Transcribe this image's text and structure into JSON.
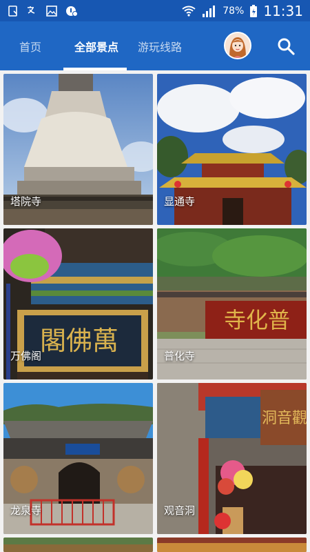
{
  "status_bar": {
    "battery": "78%",
    "time": "11:31"
  },
  "tabs": [
    {
      "label": "首页",
      "selected": false
    },
    {
      "label": "全部景点",
      "selected": true
    },
    {
      "label": "游玩线路",
      "selected": false
    }
  ],
  "icons": {
    "search": "search-icon",
    "avatar": "avatar"
  },
  "colors": {
    "status_bar": "#1757b2",
    "app_bar": "#1f67c4",
    "background": "#f2f2f2"
  },
  "cards": [
    {
      "label": "塔院寺"
    },
    {
      "label": "显通寺"
    },
    {
      "label": "万佛阁"
    },
    {
      "label": "普化寺"
    },
    {
      "label": "龙泉寺"
    },
    {
      "label": "观音洞"
    }
  ]
}
